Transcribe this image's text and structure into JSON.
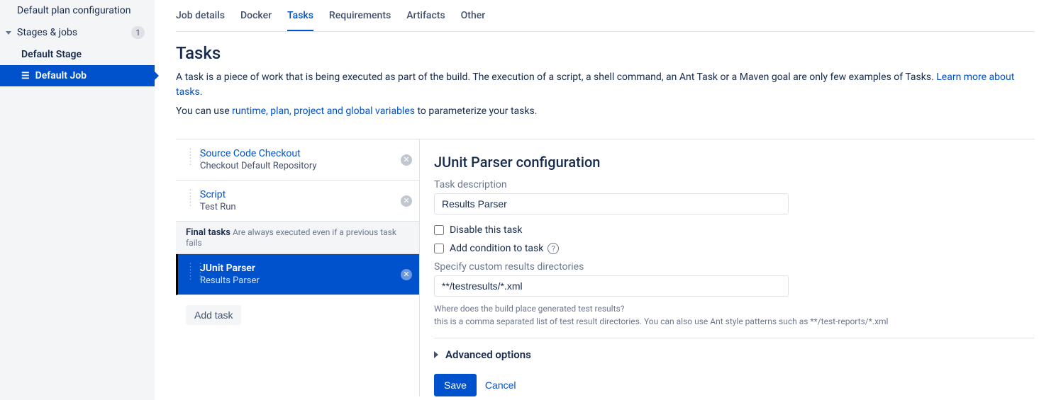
{
  "sidebar": {
    "default_plan": "Default plan configuration",
    "stages_jobs": "Stages & jobs",
    "stages_badge": "1",
    "default_stage": "Default Stage",
    "default_job": "Default Job"
  },
  "tabs": [
    {
      "label": "Job details"
    },
    {
      "label": "Docker"
    },
    {
      "label": "Tasks",
      "active": true
    },
    {
      "label": "Requirements"
    },
    {
      "label": "Artifacts"
    },
    {
      "label": "Other"
    }
  ],
  "heading": "Tasks",
  "desc": {
    "main": "A task is a piece of work that is being executed as part of the build. The execution of a script, a shell command, an Ant Task or a Maven goal are only few examples of Tasks. ",
    "learn_link": "Learn more about tasks",
    "vars_pre": "You can use ",
    "vars_link": "runtime, plan, project and global variables",
    "vars_post": " to parameterize your tasks."
  },
  "tasks": [
    {
      "title": "Source Code Checkout",
      "desc": "Checkout Default Repository"
    },
    {
      "title": "Script",
      "desc": "Test Run"
    }
  ],
  "final_label": "Final tasks",
  "final_hint": "Are always executed even if a previous task fails",
  "selected_task": {
    "title": "JUnit Parser",
    "desc": "Results Parser"
  },
  "add_task": "Add task",
  "config": {
    "title": "JUnit Parser configuration",
    "desc_label": "Task description",
    "desc_value": "Results Parser",
    "disable_label": "Disable this task",
    "condition_label": "Add condition to task",
    "dirs_label": "Specify custom results directories",
    "dirs_value": "**/testresults/*.xml",
    "hint_line1": "Where does the build place generated test results?",
    "hint_line2": "this is a comma separated list of test result directories. You can also use Ant style patterns such as **/test-reports/*.xml",
    "advanced": "Advanced options",
    "save": "Save",
    "cancel": "Cancel"
  }
}
